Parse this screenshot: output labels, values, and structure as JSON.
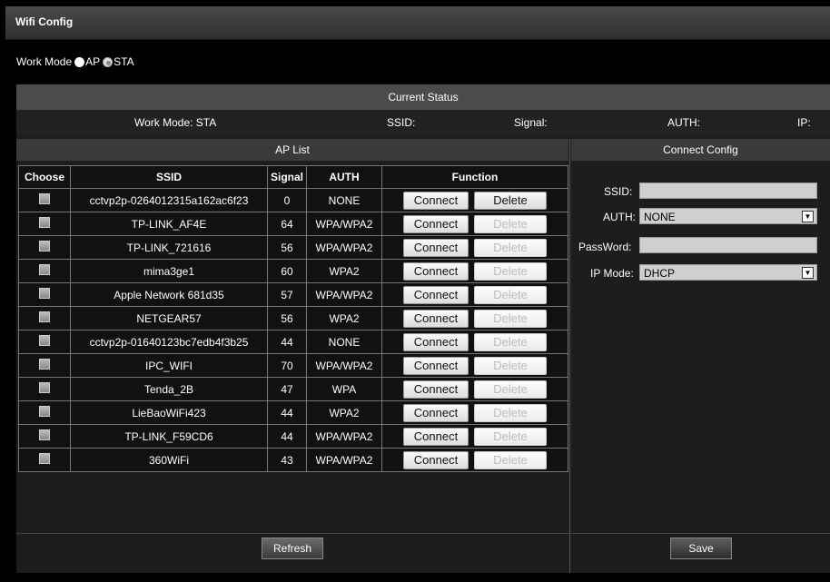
{
  "title": "Wifi Config",
  "work_mode": {
    "label": "Work Mode",
    "options": [
      {
        "label": "AP",
        "selected": false
      },
      {
        "label": "STA",
        "selected": true
      }
    ]
  },
  "current_status": {
    "header": "Current Status",
    "work_mode": "Work Mode: STA",
    "ssid": "SSID:",
    "signal": "Signal:",
    "auth": "AUTH:",
    "ip": "IP:"
  },
  "ap_list": {
    "header": "AP List",
    "columns": [
      "Choose",
      "SSID",
      "Signal",
      "AUTH",
      "Function"
    ],
    "connect_label": "Connect",
    "delete_label": "Delete",
    "rows": [
      {
        "ssid": "cctvp2p-0264012315a162ac6f23",
        "signal": "0",
        "auth": "NONE",
        "delete_enabled": true
      },
      {
        "ssid": "TP-LINK_AF4E",
        "signal": "64",
        "auth": "WPA/WPA2",
        "delete_enabled": false
      },
      {
        "ssid": "TP-LINK_721616",
        "signal": "56",
        "auth": "WPA/WPA2",
        "delete_enabled": false
      },
      {
        "ssid": "mima3ge1",
        "signal": "60",
        "auth": "WPA2",
        "delete_enabled": false
      },
      {
        "ssid": "Apple Network 681d35",
        "signal": "57",
        "auth": "WPA/WPA2",
        "delete_enabled": false
      },
      {
        "ssid": "NETGEAR57",
        "signal": "56",
        "auth": "WPA2",
        "delete_enabled": false
      },
      {
        "ssid": "cctvp2p-01640123bc7edb4f3b25",
        "signal": "44",
        "auth": "NONE",
        "delete_enabled": false
      },
      {
        "ssid": "IPC_WIFI",
        "signal": "70",
        "auth": "WPA/WPA2",
        "delete_enabled": false
      },
      {
        "ssid": "Tenda_2B",
        "signal": "47",
        "auth": "WPA",
        "delete_enabled": false
      },
      {
        "ssid": "LieBaoWiFi423",
        "signal": "44",
        "auth": "WPA2",
        "delete_enabled": false
      },
      {
        "ssid": "TP-LINK_F59CD6",
        "signal": "44",
        "auth": "WPA/WPA2",
        "delete_enabled": false
      },
      {
        "ssid": "360WiFi",
        "signal": "43",
        "auth": "WPA/WPA2",
        "delete_enabled": false
      }
    ]
  },
  "connect_config": {
    "header": "Connect Config",
    "ssid_label": "SSID:",
    "ssid_value": "",
    "auth_label": "AUTH:",
    "auth_value": "NONE",
    "password_label": "PassWord:",
    "password_value": "",
    "ip_mode_label": "IP Mode:",
    "ip_mode_value": "DHCP"
  },
  "buttons": {
    "refresh": "Refresh",
    "save": "Save"
  },
  "icons": {
    "dropdown": "chevron-down-icon"
  }
}
